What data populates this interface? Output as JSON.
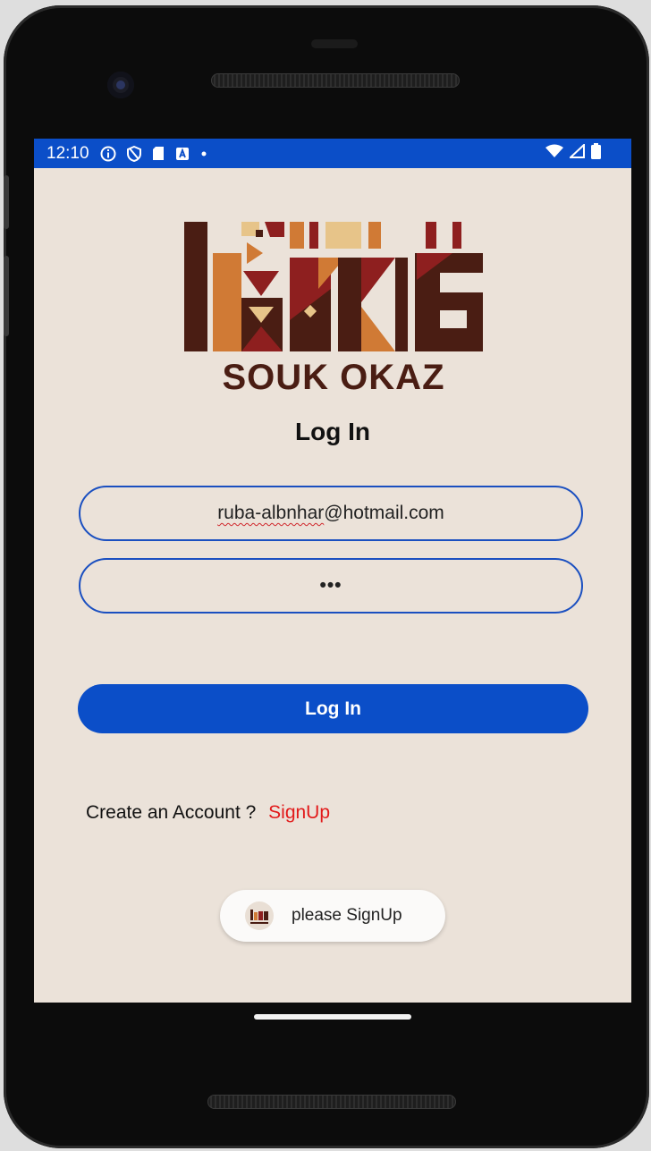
{
  "status_bar": {
    "time": "12:10",
    "left_icons": [
      "info-icon",
      "shield-icon",
      "sd-card-icon",
      "app-a-icon",
      "dot-icon"
    ],
    "right_icons": [
      "wifi-icon",
      "signal-icon",
      "battery-icon"
    ]
  },
  "logo": {
    "text": "SOUK OKAZ"
  },
  "login": {
    "title": "Log In",
    "email_value": "ruba-albnhar@hotmail.com",
    "email_underlined": "ruba-albnhar",
    "email_rest": "@hotmail.com",
    "password_value": "•••",
    "button_label": "Log In"
  },
  "signup_prompt": {
    "text": "Create an Account ?",
    "link": "SignUp"
  },
  "toast": {
    "text": "please SignUp"
  },
  "colors": {
    "accent": "#0b4ec8",
    "background": "#ebe2d9",
    "link": "#e21a1a",
    "logo_dark": "#4a1d13",
    "logo_red": "#8e1f1f",
    "logo_orange": "#d07a35",
    "logo_sand": "#e7c489"
  }
}
